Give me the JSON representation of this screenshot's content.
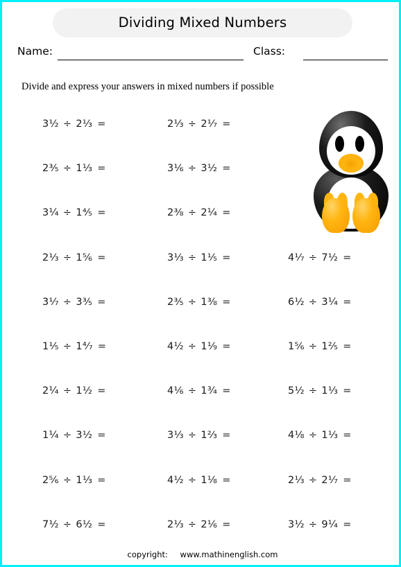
{
  "worksheet": {
    "title": "Dividing Mixed Numbers",
    "name_label": "Name:",
    "class_label": "Class:",
    "instructions": "Divide and express your answers in mixed numbers if possible",
    "border_color": "#00f0f8",
    "title_bar_color": "#f2f2f2"
  },
  "mascot": {
    "name": "penguin",
    "body_color": "#000000",
    "belly_color": "#ffffff",
    "beak_color": "#ffb511",
    "feet_color": "#ffb511"
  },
  "operators": {
    "divide": "÷",
    "equals": "="
  },
  "problems": {
    "columns": 3,
    "rows": [
      {
        "col1": {
          "a": "3½",
          "b": "2⅓"
        },
        "col2": {
          "a": "2⅓",
          "b": "2⅐"
        },
        "col3": null
      },
      {
        "col1": {
          "a": "2⅗",
          "b": "1⅓"
        },
        "col2": {
          "a": "3⅙",
          "b": "3½"
        },
        "col3": null
      },
      {
        "col1": {
          "a": "3¼",
          "b": "1⅘"
        },
        "col2": {
          "a": "2⅜",
          "b": "2¼"
        },
        "col3": null
      },
      {
        "col1": {
          "a": "2⅓",
          "b": "1⅚"
        },
        "col2": {
          "a": "3⅓",
          "b": "1⅕"
        },
        "col3": {
          "a": "4⅐",
          "b": "7½"
        }
      },
      {
        "col1": {
          "a": "3⅐",
          "b": "3⅗"
        },
        "col2": {
          "a": "2⅗",
          "b": "1⅜"
        },
        "col3": {
          "a": "6½",
          "b": "3¼"
        }
      },
      {
        "col1": {
          "a": "1⅕",
          "b": "1⁴⁄₇"
        },
        "col2": {
          "a": "4½",
          "b": "1⅑"
        },
        "col3": {
          "a": "1⅚",
          "b": "1⅖"
        }
      },
      {
        "col1": {
          "a": "2¼",
          "b": "1½"
        },
        "col2": {
          "a": "4⅙",
          "b": "1¾"
        },
        "col3": {
          "a": "5½",
          "b": "1⅓"
        }
      },
      {
        "col1": {
          "a": "1¼",
          "b": "3½"
        },
        "col2": {
          "a": "3⅓",
          "b": "1⅔"
        },
        "col3": {
          "a": "4⅛",
          "b": "1⅓"
        }
      },
      {
        "col1": {
          "a": "2⅚",
          "b": "1⅓"
        },
        "col2": {
          "a": "4½",
          "b": "1⅛"
        },
        "col3": {
          "a": "2⅓",
          "b": "2⅐"
        }
      },
      {
        "col1": {
          "a": "7½",
          "b": "6½"
        },
        "col2": {
          "a": "2⅓",
          "b": "2⅙"
        },
        "col3": {
          "a": "3½",
          "b": "9¼"
        }
      }
    ]
  },
  "footer": {
    "copyright_label": "copyright:",
    "site": "www.mathinenglish.com"
  }
}
